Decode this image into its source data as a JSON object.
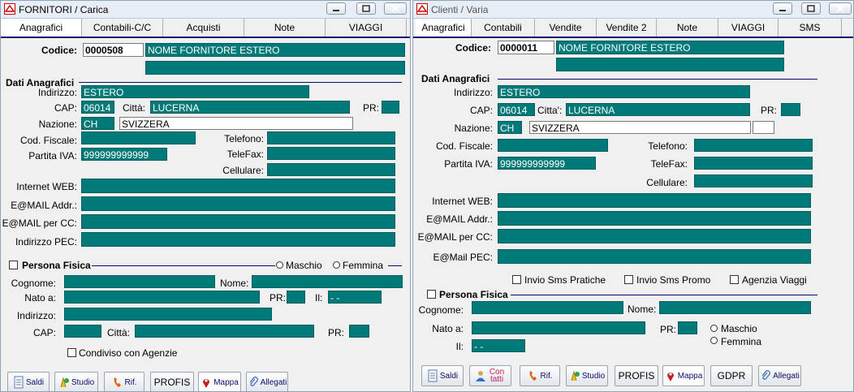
{
  "left": {
    "title": "FORNITORI / Carica",
    "tabs": [
      "Anagrafici",
      "Contabili-C/C",
      "Acquisti",
      "Note",
      "VIAGGI"
    ],
    "codice_label": "Codice:",
    "codice": "0000508",
    "nome": "NOME FORNITORE ESTERO",
    "nome2": "",
    "section_dati": "Dati Anagrafici",
    "indirizzo_label": "Indirizzo:",
    "indirizzo": "ESTERO",
    "cap_label": "CAP:",
    "cap": "06014",
    "citta_label": "Città:",
    "citta": "LUCERNA",
    "pr_label": "PR:",
    "pr": "",
    "nazione_label": "Nazione:",
    "nazione_code": "CH",
    "nazione": "SVIZZERA",
    "codfisc_label": "Cod. Fiscale:",
    "codfisc": "",
    "telefono_label": "Telefono:",
    "telefono": "",
    "piva_label": "Partita IVA:",
    "piva": "999999999999",
    "telefax_label": "TeleFax:",
    "telefax": "",
    "cellulare_label": "Cellulare:",
    "cellulare": "",
    "web_label": "Internet WEB:",
    "web": "",
    "email_label": "E@MAIL Addr.:",
    "email": "",
    "emailcc_label": "E@MAIL per CC:",
    "emailcc": "",
    "pec_label": "Indirizzo PEC:",
    "pec": "",
    "section_persona": "Persona Fisica",
    "maschio": "Maschio",
    "femmina": "Femmina",
    "cognome_label": "Cognome:",
    "cognome": "",
    "nome_label": "Nome:",
    "nome_pf": "",
    "natoa_label": "Nato a:",
    "natoa": "",
    "pr2_label": "PR:",
    "pr2": "",
    "il_label": "Il:",
    "il": " -  -",
    "indirizzo2_label": "Indirizzo:",
    "indirizzo2": "",
    "cap2_label": "CAP:",
    "cap2": "",
    "citta2_label": "Città:",
    "citta2": "",
    "pr3_label": "PR:",
    "pr3": "",
    "condiviso": "Condiviso con Agenzie",
    "buttons": [
      "Saldi",
      "Studio",
      "Rif.",
      "PROFIS",
      "Mappa",
      "Allegati"
    ]
  },
  "right": {
    "title": "Clienti / Varia",
    "tabs": [
      "Anagrafici",
      "Contabili",
      "Vendite",
      "Vendite 2",
      "Note",
      "VIAGGI",
      "SMS"
    ],
    "codice_label": "Codice:",
    "codice": "0000011",
    "nome": "NOME FORNITORE ESTERO",
    "nome2": "",
    "section_dati": "Dati Anagrafici",
    "indirizzo_label": "Indirizzo:",
    "indirizzo": "ESTERO",
    "cap_label": "CAP:",
    "cap": "06014",
    "citta_label": "Citta':",
    "citta": "LUCERNA",
    "pr_label": "PR:",
    "pr": "",
    "nazione_label": "Nazione:",
    "nazione_code": "CH",
    "nazione": "SVIZZERA",
    "nazione_extra": "",
    "codfisc_label": "Cod. Fiscale:",
    "codfisc": "",
    "telefono_label": "Telefono:",
    "telefono": "",
    "piva_label": "Partita IVA:",
    "piva": "999999999999",
    "telefax_label": "TeleFax:",
    "telefax": "",
    "cellulare_label": "Cellulare:",
    "cellulare": "",
    "web_label": "Internet WEB:",
    "web": "",
    "email_label": "E@MAIL Addr.:",
    "email": "",
    "emailcc_label": "E@MAIL per CC:",
    "emailcc": "",
    "pec_label": "E@Mail PEC:",
    "pec": "",
    "sms_pratiche": "Invio Sms Pratiche",
    "sms_promo": "Invio Sms Promo",
    "agenzia": "Agenzia Viaggi",
    "section_persona": "Persona Fisica",
    "cognome_label": "Cognome:",
    "cognome": "",
    "nome_label": "Nome:",
    "nome_pf": "",
    "natoa_label": "Nato a:",
    "natoa": "",
    "pr2_label": "PR:",
    "pr2": "",
    "maschio": "Maschio",
    "femmina": "Femmina",
    "il_label": "Il:",
    "il": " -  -",
    "buttons": [
      "Saldi",
      "Con tatti",
      "Rif.",
      "Studio",
      "PROFIS",
      "Mappa",
      "GDPR",
      "Allegati"
    ]
  }
}
